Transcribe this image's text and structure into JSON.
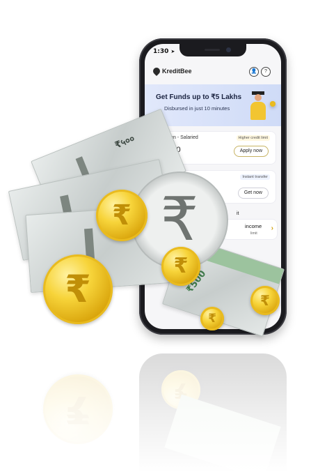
{
  "status_bar": {
    "time": "1:30"
  },
  "app": {
    "name": "KreditBee"
  },
  "header": {
    "profile_icon": "user-icon",
    "help_icon": "question-icon",
    "help_glyph": "?"
  },
  "banner": {
    "title": "Get Funds up to ₹5 Lakhs",
    "subtitle": "Disbursed in just 10 minutes"
  },
  "cards": [
    {
      "title": "nal Loan - Salaried",
      "tag": "Higher credit limit",
      "amount": "00,000",
      "sub": "n",
      "button": "Apply now"
    },
    {
      "title": "",
      "tag": "Instant transfer",
      "button": "Get now"
    }
  ],
  "section": {
    "label": "it"
  },
  "income_card": {
    "title": "income",
    "sub": "limit"
  },
  "notes": [
    {
      "denomination": "₹५००"
    },
    {
      "denomination": "₹500"
    }
  ],
  "colors": {
    "accent": "#d9a40b",
    "banner_bg": "#cfdbf7",
    "phone_body": "#1b1b1f"
  }
}
